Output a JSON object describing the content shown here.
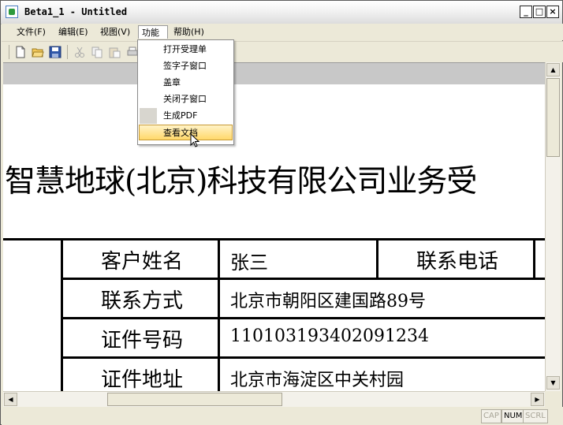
{
  "window": {
    "title": "Beta1_1 - Untitled"
  },
  "window_buttons": {
    "minimize": "_",
    "maximize": "□",
    "close": "×"
  },
  "menubar": {
    "items": [
      "文件(F)",
      "编辑(E)",
      "视图(V)",
      "功能",
      "帮助(H)"
    ],
    "active_index": 3
  },
  "toolbar": {
    "icons": [
      "new-file-icon",
      "open-folder-icon",
      "save-icon",
      "cut-icon",
      "copy-icon",
      "paste-icon",
      "print-icon"
    ]
  },
  "dropdown": {
    "items": [
      "打开受理单",
      "签字子窗口",
      "盖章",
      "关闭子窗口",
      "生成PDF",
      "查看文档"
    ],
    "hover_index": 5
  },
  "document": {
    "heading": "智慧地球(北京)科技有限公司业务受",
    "rows": [
      {
        "label": "客户姓名",
        "value": "张三",
        "label2": "联系电话"
      },
      {
        "label": "联系方式",
        "value": "北京市朝阳区建国路89号"
      },
      {
        "label": "证件号码",
        "value": "110103193402091234"
      },
      {
        "label": "证件地址",
        "value": "北京市海淀区中关村园"
      }
    ]
  },
  "statusbar": {
    "indicators": [
      "CAP",
      "NUM",
      "SCRL"
    ],
    "active": "NUM"
  }
}
